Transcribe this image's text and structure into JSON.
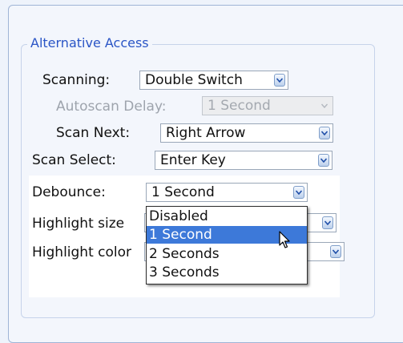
{
  "fieldset": {
    "legend": "Alternative Access"
  },
  "rows": {
    "scanning": {
      "label": "Scanning:",
      "value": "Double Switch"
    },
    "autoscan_delay": {
      "label": "Autoscan Delay:",
      "value": "1 Second"
    },
    "scan_next": {
      "label": "Scan Next:",
      "value": "Right Arrow"
    },
    "scan_select": {
      "label": "Scan Select:",
      "value": "Enter Key"
    },
    "debounce": {
      "label": "Debounce:",
      "value": "1 Second"
    },
    "highlight_size": {
      "label": "Highlight size"
    },
    "highlight_color": {
      "label": "Highlight color"
    }
  },
  "dropdown": {
    "options": [
      "Disabled",
      "1 Second",
      "2 Seconds",
      "3 Seconds"
    ],
    "selected": "1 Second"
  },
  "colors": {
    "accent": "#2a55c6",
    "selection": "#3d79d9",
    "disabled_text": "#9ea4ad"
  },
  "icons": {
    "dropdown_arrow": "chevron-down-icon",
    "pointer": "mouse-pointer-icon"
  }
}
